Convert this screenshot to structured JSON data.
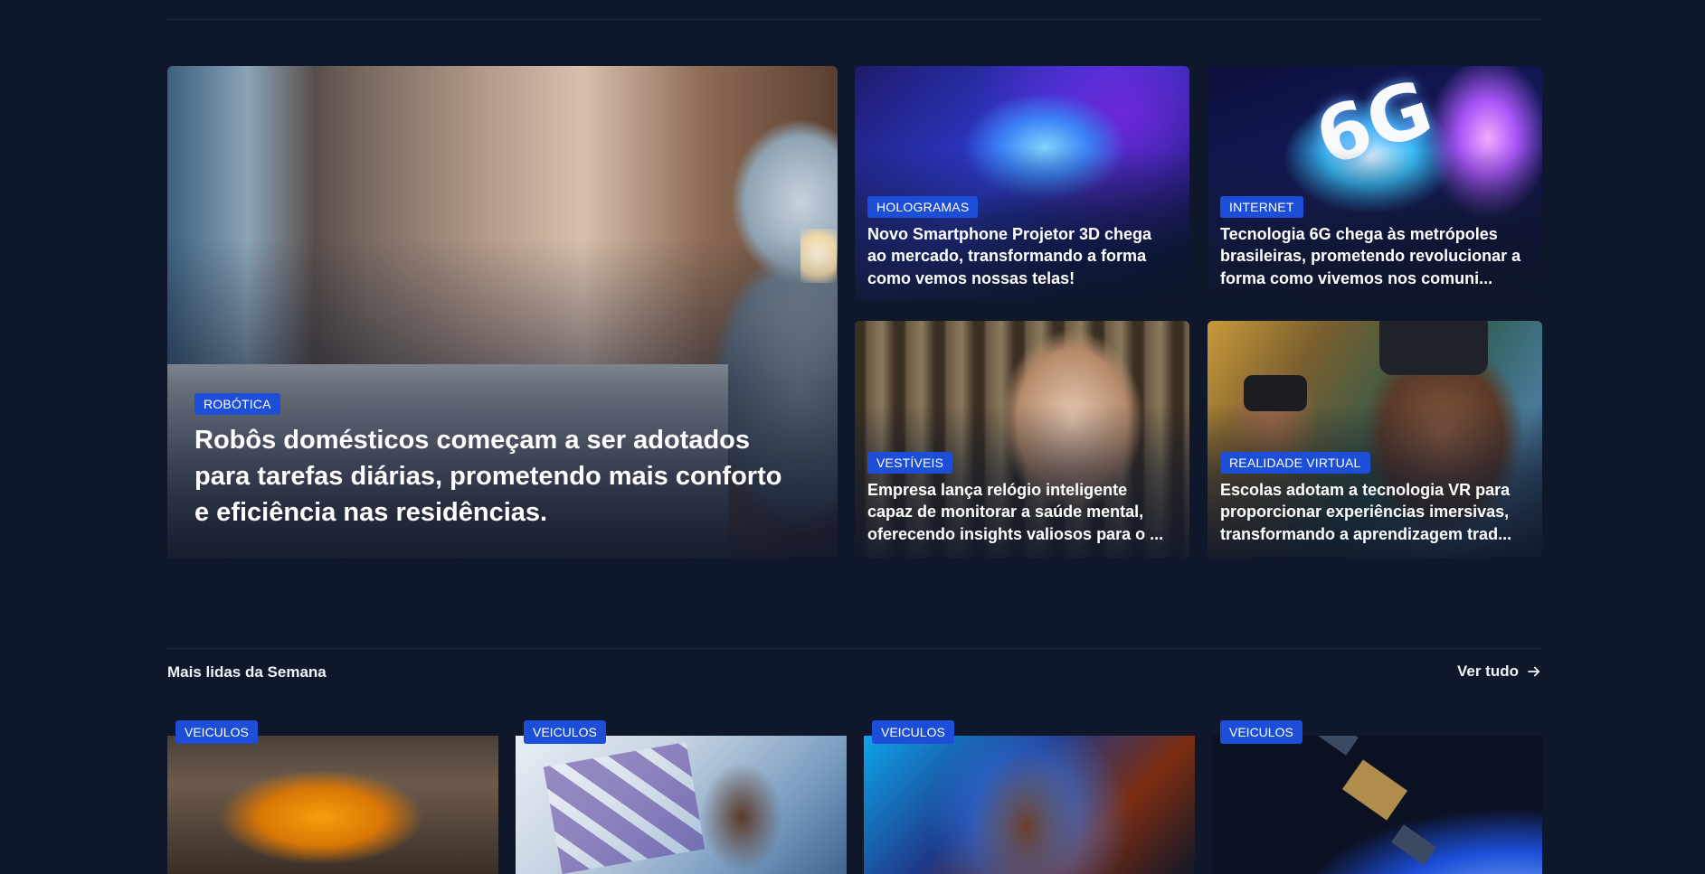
{
  "header": {
    "cut_text": "…"
  },
  "featured": {
    "main": {
      "category": "ROBÓTICA",
      "title": "Robôs domésticos começam a ser adotados para tarefas diárias, prometendo mais conforto e eficiência nas residências."
    },
    "cards": [
      {
        "category": "HOLOGRAMAS",
        "title": "Novo Smartphone Projetor 3D chega ao mercado, transformando a forma como vemos nossas telas!"
      },
      {
        "category": "INTERNET",
        "title": "Tecnologia 6G chega às metrópoles brasileiras, prometendo revolucionar a forma como vivemos nos comuni..."
      },
      {
        "category": "VESTÍVEIS",
        "title": "Empresa lança relógio inteligente capaz de monitorar a saúde mental, oferecendo insights valiosos para o ..."
      },
      {
        "category": "REALIDADE VIRTUAL",
        "title": "Escolas adotam a tecnologia VR para proporcionar experiências imersivas, transformando a aprendizagem trad..."
      }
    ]
  },
  "most_read": {
    "title": "Mais lidas da Semana",
    "see_all": "Ver tudo",
    "items": [
      {
        "category": "VEICULOS"
      },
      {
        "category": "VEICULOS"
      },
      {
        "category": "VEICULOS"
      },
      {
        "category": "VEICULOS"
      }
    ]
  },
  "colors": {
    "background": "#0f172a",
    "badge": "#1d4ed8"
  }
}
